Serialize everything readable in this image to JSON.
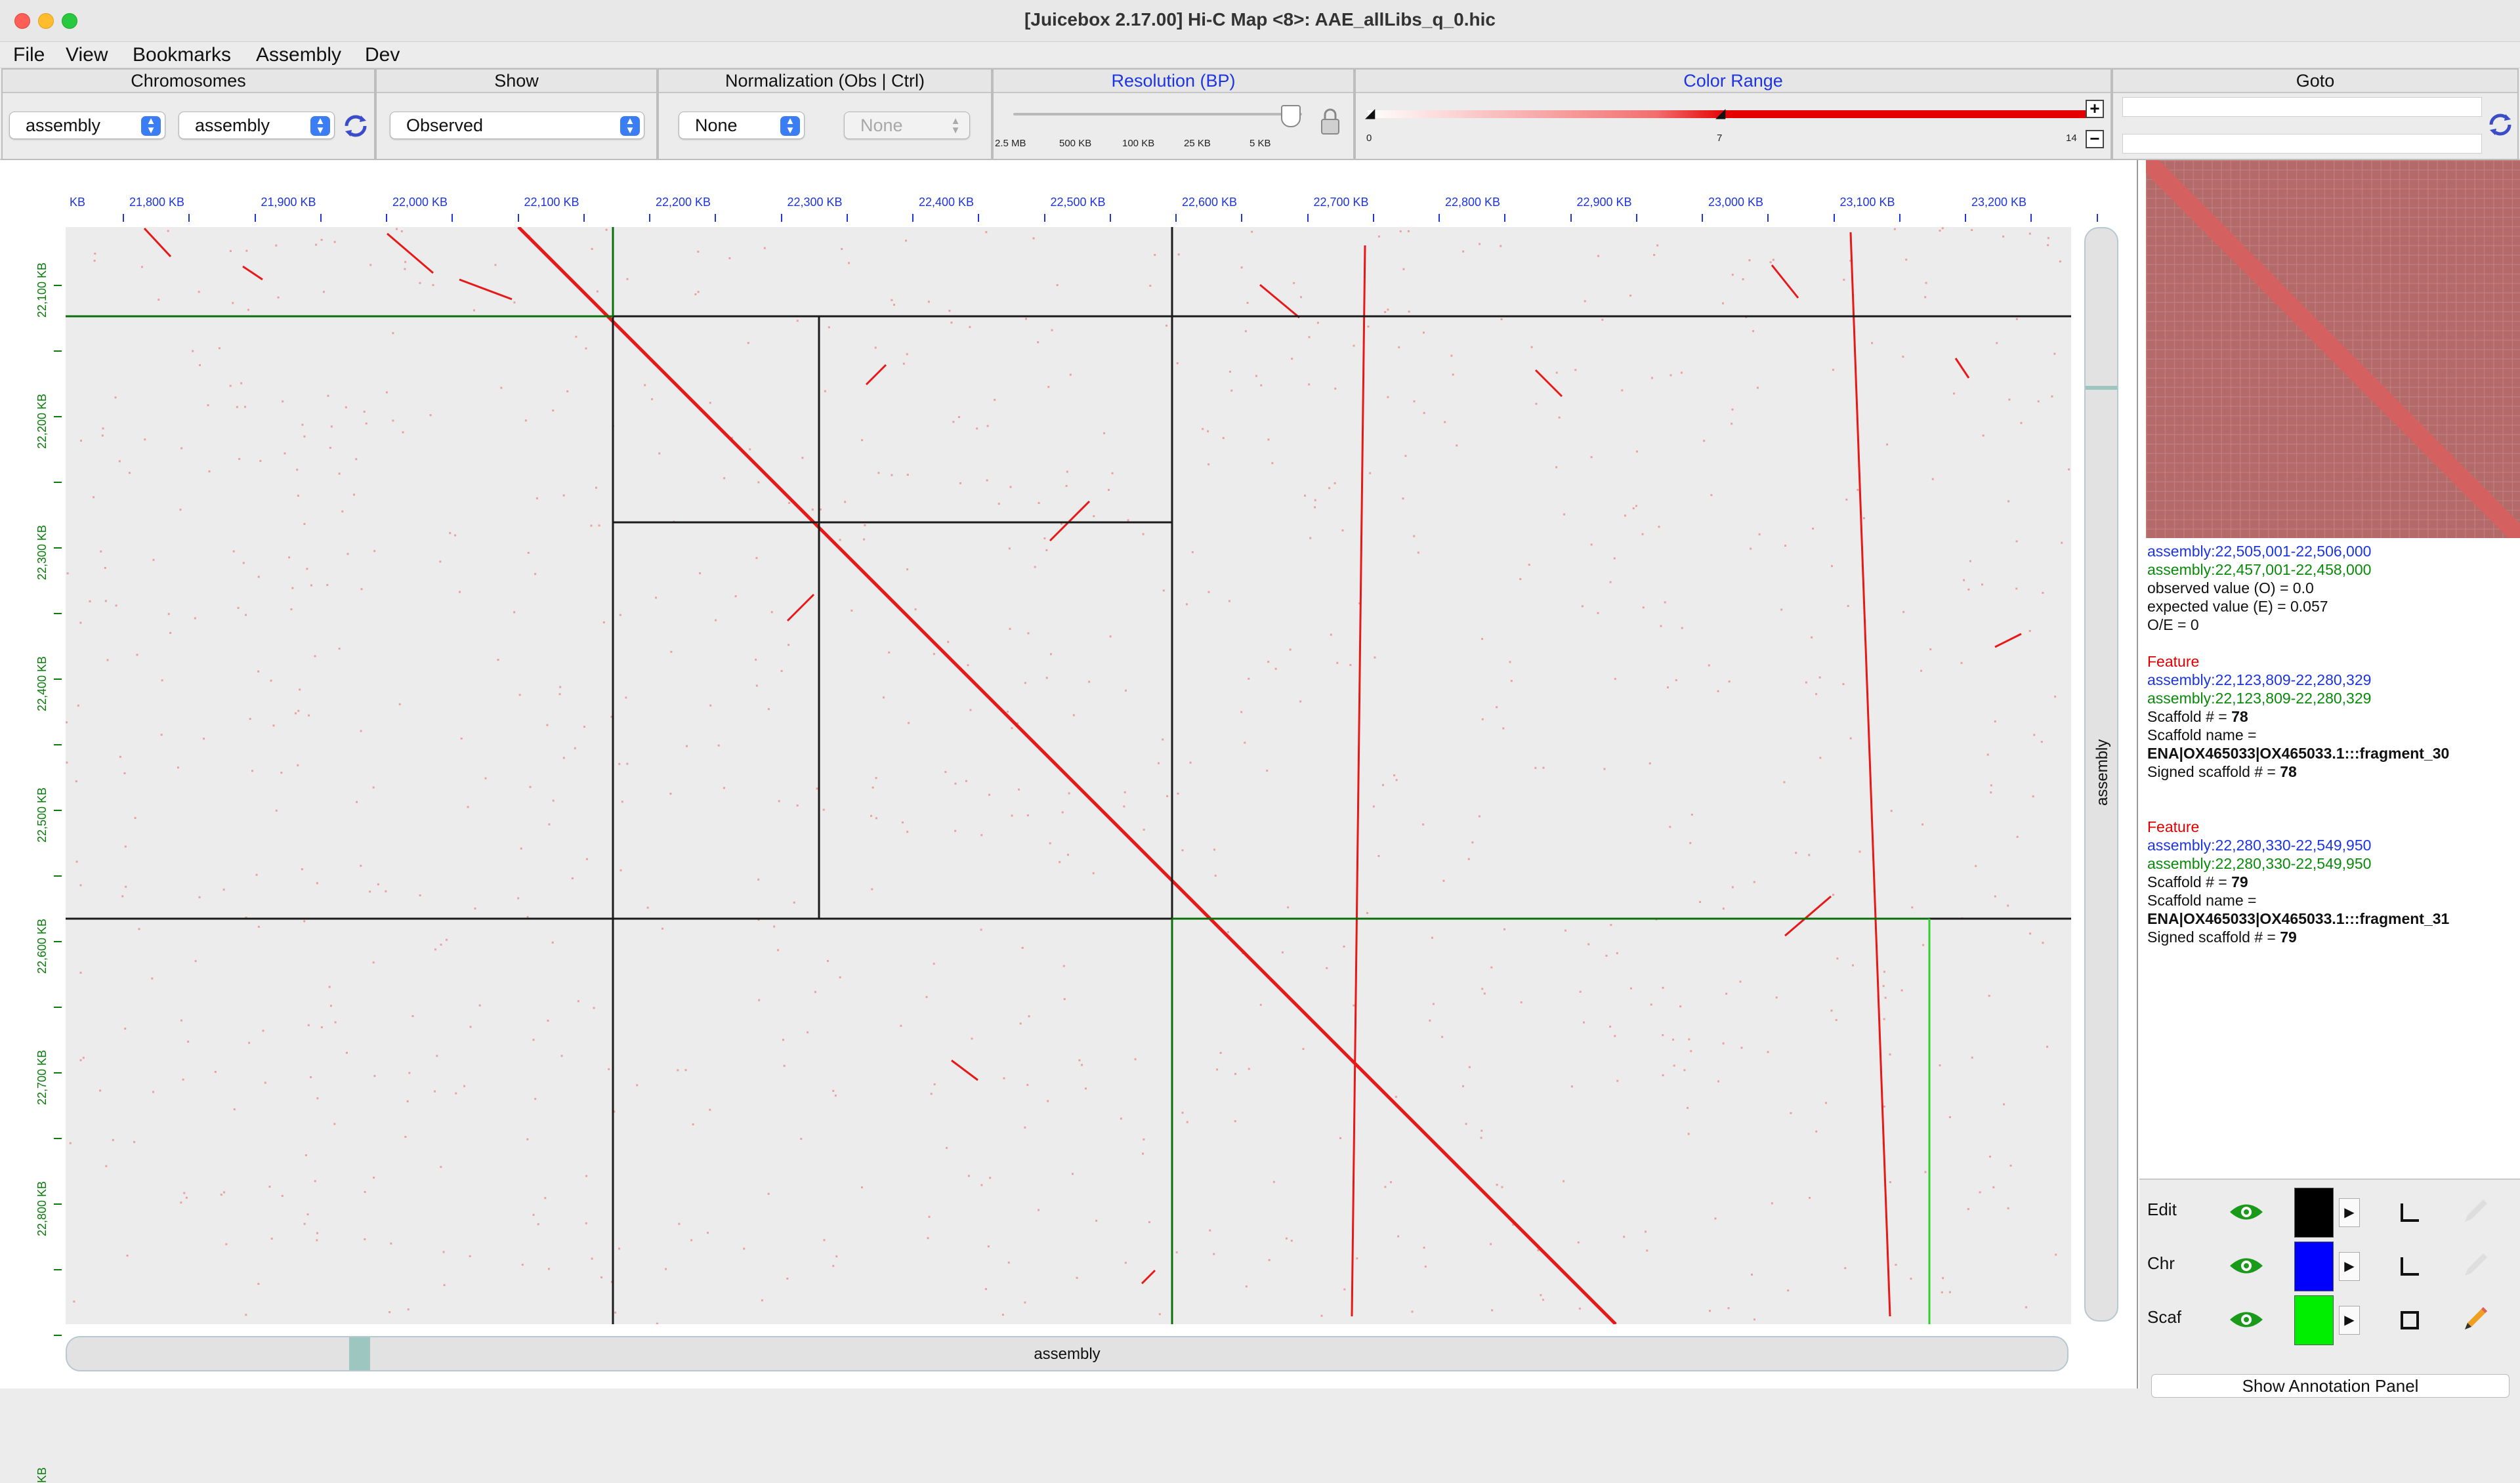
{
  "window": {
    "title": "[Juicebox 2.17.00] Hi-C Map <8>: AAE_allLibs_q_0.hic"
  },
  "menu": [
    "File",
    "View",
    "Bookmarks",
    "Assembly",
    "Dev"
  ],
  "panels": {
    "chromosomes": {
      "header": "Chromosomes",
      "chr1": "assembly",
      "chr2": "assembly"
    },
    "show": {
      "header": "Show",
      "value": "Observed"
    },
    "normalization": {
      "header": "Normalization  (Obs  |  Ctrl)",
      "obs": "None",
      "ctrl": "None"
    },
    "resolution": {
      "header": "Resolution (BP)",
      "ticks": [
        "2.5 MB",
        "500 KB",
        "100 KB",
        "25 KB",
        "5 KB"
      ]
    },
    "color_range": {
      "header": "Color Range",
      "min": "0",
      "mid": "7",
      "max": "14",
      "current_min": 0,
      "current_max": 7
    },
    "goto": {
      "header": "Goto",
      "field1": "",
      "field2": ""
    }
  },
  "map": {
    "x_unit": "KB",
    "x_ticks": [
      "21,800 KB",
      "21,900 KB",
      "22,000 KB",
      "22,100 KB",
      "22,200 KB",
      "22,300 KB",
      "22,400 KB",
      "22,500 KB",
      "22,600 KB",
      "22,700 KB",
      "22,800 KB",
      "22,900 KB",
      "23,000 KB",
      "23,100 KB",
      "23,200 KB"
    ],
    "y_ticks": [
      "22,100 KB",
      "22,200 KB",
      "22,300 KB",
      "22,400 KB",
      "22,500 KB",
      "22,600 KB",
      "22,700 KB",
      "22,800 KB"
    ],
    "y_unit": "KB",
    "h_scroll_label": "assembly",
    "v_scroll_label": "assembly",
    "colors": {
      "contact": "#e81818",
      "background": "#ececec",
      "scaffold": "#1a1a1a",
      "selection": "#2fcf2f"
    }
  },
  "info": {
    "coord_x": "assembly:22,505,001-22,506,000",
    "coord_y": "assembly:22,457,001-22,458,000",
    "observed": "observed value (O) = 0.0",
    "expected": "expected value (E) = 0.057",
    "oe": "O/E = 0",
    "features": [
      {
        "title": "Feature",
        "x": "assembly:22,123,809-22,280,329",
        "y": "assembly:22,123,809-22,280,329",
        "scaffold_label": "Scaffold # = ",
        "scaffold_num": "78",
        "name_label": "Scaffold name =",
        "name": "ENA|OX465033|OX465033.1:::fragment_30",
        "signed_label": "Signed scaffold # = ",
        "signed": "78"
      },
      {
        "title": "Feature",
        "x": "assembly:22,280,330-22,549,950",
        "y": "assembly:22,280,330-22,549,950",
        "scaffold_label": "Scaffold # = ",
        "scaffold_num": "79",
        "name_label": "Scaffold name =",
        "name": "ENA|OX465033|OX465033.1:::fragment_31",
        "signed_label": "Signed scaffold # = ",
        "signed": "79"
      }
    ]
  },
  "annotations": {
    "rows": [
      {
        "label": "Edit",
        "color": "#000000"
      },
      {
        "label": "Chr",
        "color": "#0000ff"
      },
      {
        "label": "Scaf",
        "color": "#00ee00"
      }
    ],
    "show_button": "Show Annotation Panel"
  }
}
